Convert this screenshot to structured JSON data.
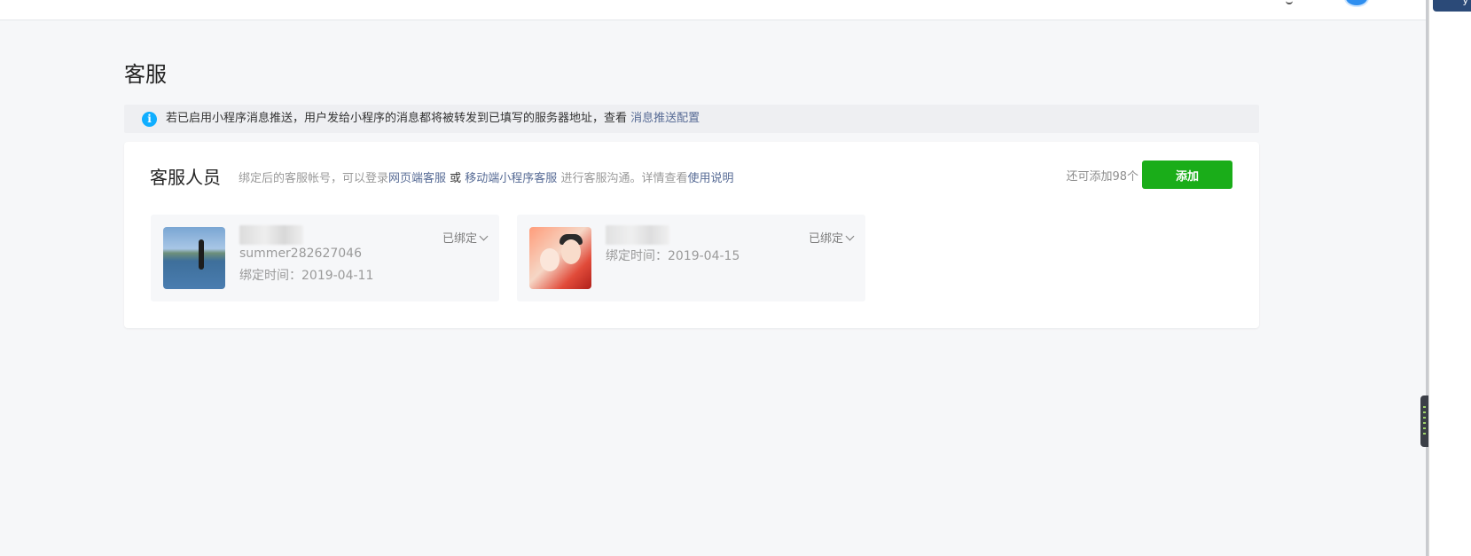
{
  "page": {
    "title": "客服"
  },
  "notice": {
    "icon": "info-icon",
    "icon_glyph": "i",
    "text": "若已启用小程序消息推送，用户发给小程序的消息都将被转发到已填写的服务器地址，查看",
    "link": "消息推送配置"
  },
  "section": {
    "title": "客服人员",
    "desc_part1": "绑定后的客服帐号，可以登录",
    "link_web": "网页端客服",
    "desc_or": " 或 ",
    "link_mobile": "移动端小程序客服",
    "desc_part2": " 进行客服沟通。详情查看",
    "link_help": "使用说明",
    "remaining": "还可添加98个",
    "add_label": "添加"
  },
  "agents": [
    {
      "wechat_id": "summer282627046",
      "bind_time": "绑定时间：2019-04-11",
      "status": "已绑定"
    },
    {
      "wechat_id": "",
      "bind_time": "绑定时间：2019-04-15",
      "status": "已绑定"
    }
  ],
  "colors": {
    "primary_button": "#1aad19",
    "link": "#576b95",
    "info": "#10aeff"
  }
}
